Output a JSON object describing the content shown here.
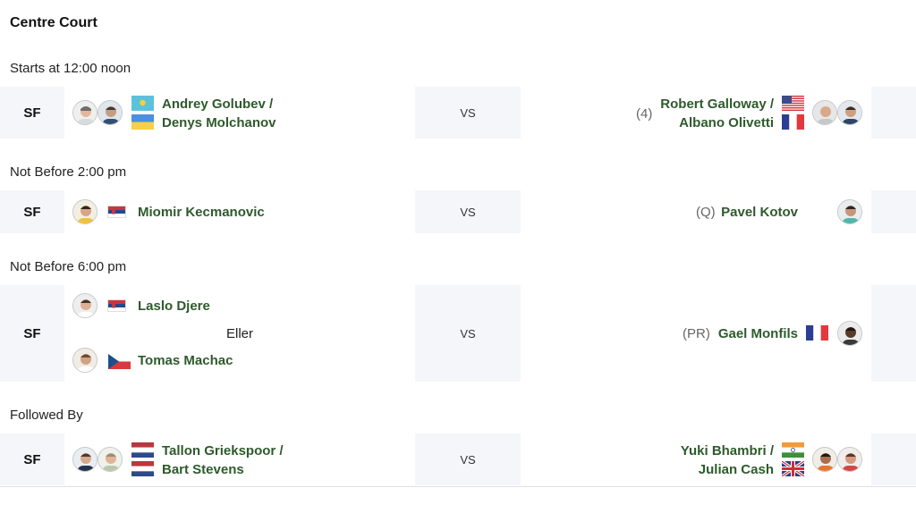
{
  "court": {
    "title": "Centre Court"
  },
  "sessions": {
    "s1": "Starts at 12:00 noon",
    "s2": "Not Before 2:00 pm",
    "s3": "Not Before 6:00 pm",
    "s4": "Followed By"
  },
  "matches": [
    {
      "round": "SF",
      "vs": "VS",
      "left": {
        "name1": "Andrey Golubev /",
        "name2": "Denys Molchanov",
        "flag1": "Kazakhstan",
        "flag2": "Ukraine"
      },
      "right": {
        "seed": "(4)",
        "name1": "Robert Galloway /",
        "name2": "Albano Olivetti",
        "flag1": "USA",
        "flag2": "France"
      }
    },
    {
      "round": "SF",
      "vs": "VS",
      "left": {
        "name": "Miomir Kecmanovic",
        "flag": "Serbia"
      },
      "right": {
        "seed": "(Q)",
        "name": "Pavel Kotov"
      }
    },
    {
      "round": "SF",
      "vs": "VS",
      "left": {
        "name1": "Laslo Djere",
        "flag1": "Serbia",
        "or": "Eller",
        "name2": "Tomas Machac",
        "flag2": "Czech Republic"
      },
      "right": {
        "seed": "(PR)",
        "name": "Gael Monfils",
        "flag": "France"
      }
    },
    {
      "round": "SF",
      "vs": "VS",
      "left": {
        "name1": "Tallon Griekspoor /",
        "name2": "Bart Stevens",
        "flag1": "Netherlands",
        "flag2": "Netherlands"
      },
      "right": {
        "name1": "Yuki Bhambri /",
        "name2": "Julian Cash",
        "flag1": "India",
        "flag2": "Great Britain"
      }
    }
  ],
  "colors": {
    "player_name": "#2e5a2c",
    "cell_bg": "#f5f6f9",
    "seed": "#666666"
  }
}
